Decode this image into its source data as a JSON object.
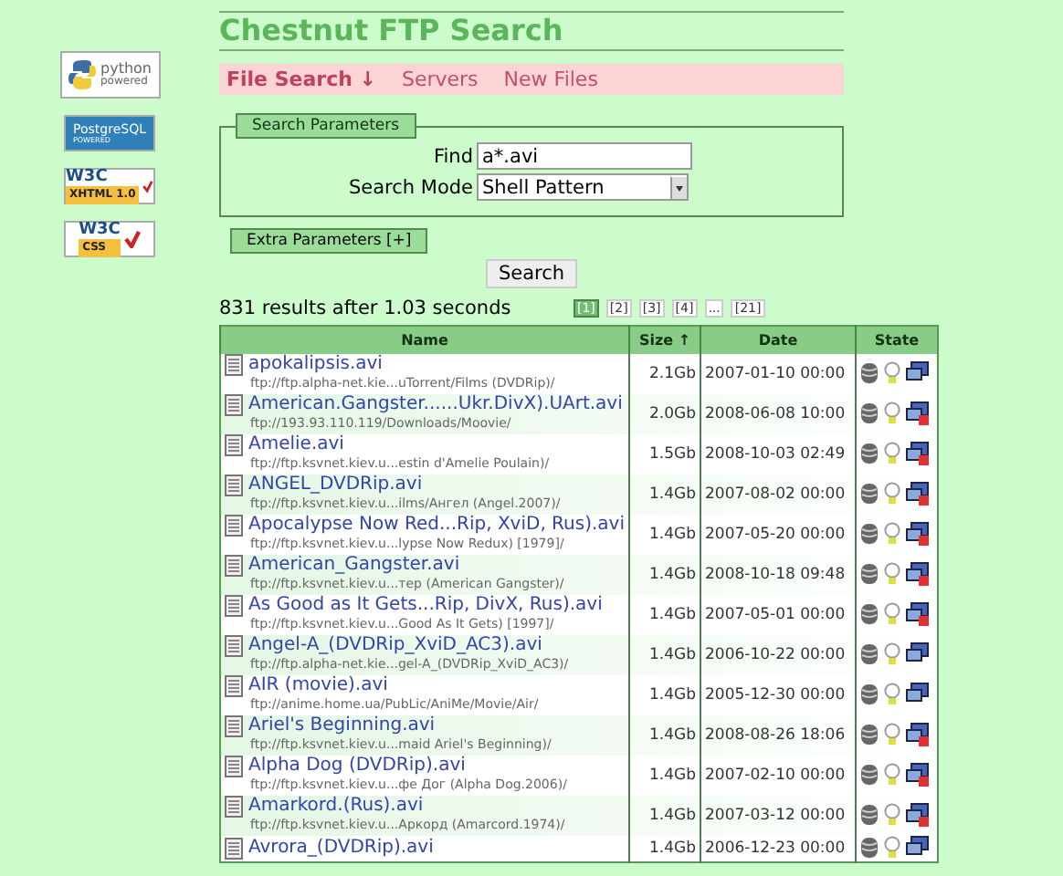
{
  "badges": [
    {
      "kind": "python",
      "texts": [
        "python",
        "powered"
      ]
    },
    {
      "kind": "postgres",
      "texts": [
        "PostgreSQL",
        "POWERED"
      ]
    },
    {
      "kind": "w3c",
      "texts": [
        "W3C",
        "XHTML 1.0"
      ]
    },
    {
      "kind": "w3c",
      "texts": [
        "W3C",
        "CSS"
      ]
    }
  ],
  "title": "Chestnut FTP Search",
  "menu": [
    {
      "label": "File Search ↓",
      "selected": true
    },
    {
      "label": "Servers",
      "selected": false
    },
    {
      "label": "New Files",
      "selected": false
    }
  ],
  "search_parameters": {
    "legend": "Search Parameters",
    "find_label": "Find",
    "find_value": "a*.avi",
    "mode_label": "Search Mode",
    "mode_value": "Shell Pattern"
  },
  "extra_button": "Extra Parameters [+]",
  "search_button": "Search",
  "results_summary": "831 results after 1.03 seconds",
  "pages": [
    {
      "label": "[1]",
      "selected": true
    },
    {
      "label": "[2]",
      "selected": false
    },
    {
      "label": "[3]",
      "selected": false
    },
    {
      "label": "[4]",
      "selected": false
    },
    {
      "label": "...",
      "selected": false
    },
    {
      "label": "[21]",
      "selected": false
    }
  ],
  "table": {
    "columns": [
      "Name",
      "Size ↑",
      "Date",
      "State"
    ],
    "rows": [
      {
        "name": "apokalipsis.avi",
        "path": "ftp://ftp.alpha-net.kie...uTorrent/Films (DVDRip)/",
        "size": "2.1Gb",
        "date": "2007-01-10 00:00",
        "offline": false
      },
      {
        "name": "American.Gangster......Ukr.DivX).UArt.avi",
        "path": "ftp://193.93.110.119/Downloads/Moovie/",
        "size": "2.0Gb",
        "date": "2008-06-08 10:00",
        "offline": true
      },
      {
        "name": "Amelie.avi",
        "path": "ftp://ftp.ksvnet.kiev.u...estin d'Amelie Poulain)/",
        "size": "1.5Gb",
        "date": "2008-10-03 02:49",
        "offline": true
      },
      {
        "name": "ANGEL_DVDRip.avi",
        "path": "ftp://ftp.ksvnet.kiev.u...ilms/Ангел (Angel.2007)/",
        "size": "1.4Gb",
        "date": "2007-08-02 00:00",
        "offline": true
      },
      {
        "name": "Apocalypse Now Red...Rip, XviD, Rus).avi",
        "path": "ftp://ftp.ksvnet.kiev.u...lypse Now Redux) [1979]/",
        "size": "1.4Gb",
        "date": "2007-05-20 00:00",
        "offline": true
      },
      {
        "name": "American_Gangster.avi",
        "path": "ftp://ftp.ksvnet.kiev.u...тер (American Gangster)/",
        "size": "1.4Gb",
        "date": "2008-10-18 09:48",
        "offline": true
      },
      {
        "name": "As Good as It Gets...Rip, DivX, Rus).avi",
        "path": "ftp://ftp.ksvnet.kiev.u...Good As It Gets) [1997]/",
        "size": "1.4Gb",
        "date": "2007-05-01 00:00",
        "offline": true
      },
      {
        "name": "Angel-A_(DVDRip_XviD_AC3).avi",
        "path": "ftp://ftp.alpha-net.kie...gel-A_(DVDRip_XviD_AC3)/",
        "size": "1.4Gb",
        "date": "2006-10-22 00:00",
        "offline": false
      },
      {
        "name": "AIR (movie).avi",
        "path": "ftp://anime.home.ua/PubLic/AniMe/Movie/Air/",
        "size": "1.4Gb",
        "date": "2005-12-30 00:00",
        "offline": false
      },
      {
        "name": "Ariel's Beginning.avi",
        "path": "ftp://ftp.ksvnet.kiev.u...maid Ariel's Beginning)/",
        "size": "1.4Gb",
        "date": "2008-08-26 18:06",
        "offline": true
      },
      {
        "name": "Alpha Dog (DVDRip).avi",
        "path": "ftp://ftp.ksvnet.kiev.u...фе Дог (Alpha Dog.2006)/",
        "size": "1.4Gb",
        "date": "2007-02-10 00:00",
        "offline": true
      },
      {
        "name": "Amarkord.(Rus).avi",
        "path": "ftp://ftp.ksvnet.kiev.u...Аркорд (Amarcord.1974)/",
        "size": "1.4Gb",
        "date": "2007-03-12 00:00",
        "offline": true
      },
      {
        "name": "Avrora_(DVDRip).avi",
        "size": "1.4Gb",
        "date": "2006-12-23 00:00",
        "offline": false
      }
    ]
  }
}
